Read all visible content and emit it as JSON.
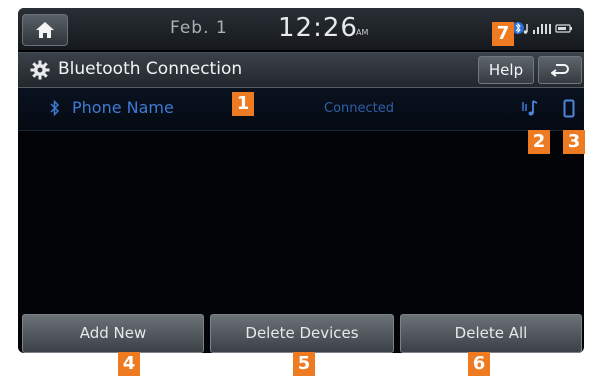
{
  "status_bar": {
    "date": "Feb.  1",
    "time": "12:26",
    "ampm": "AM",
    "icons": [
      "home-icon",
      "bluetooth-icon",
      "signal-icon",
      "battery-icon"
    ]
  },
  "title_bar": {
    "title": "Bluetooth Connection",
    "help_label": "Help",
    "icons": [
      "gear-icon",
      "back-arrow-icon"
    ]
  },
  "device_list": [
    {
      "name": "Phone Name",
      "status": "Connected",
      "icons": [
        "bluetooth-icon",
        "music-icon",
        "phone-icon"
      ]
    }
  ],
  "bottom_buttons": {
    "add_new": "Add New",
    "delete_devices": "Delete Devices",
    "delete_all": "Delete All"
  },
  "callouts": {
    "c1": "1",
    "c2": "2",
    "c3": "3",
    "c4": "4",
    "c5": "5",
    "c6": "6",
    "c7": "7"
  },
  "colors": {
    "screen_bg": "#020408",
    "device_text": "#3d7bd4",
    "callout": "#ee7a22"
  }
}
